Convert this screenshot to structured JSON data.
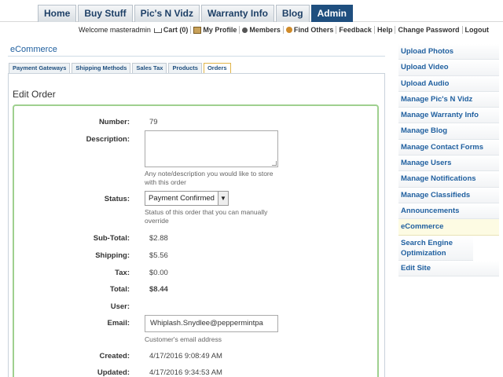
{
  "nav": {
    "tabs": [
      "Home",
      "Buy Stuff",
      "Pic's N Vidz",
      "Warranty Info",
      "Blog",
      "Admin"
    ],
    "active": "Admin"
  },
  "userbar": {
    "welcome": "Welcome masteradmin",
    "cart": "Cart (0)",
    "my_profile": "My Profile",
    "members": "Members",
    "find_others": "Find Others",
    "feedback": "Feedback",
    "help": "Help",
    "change_password": "Change Password",
    "logout": "Logout"
  },
  "section_title": "eCommerce",
  "subtabs": [
    "Payment Gateways",
    "Shipping Methods",
    "Sales Tax",
    "Products",
    "Orders"
  ],
  "active_subtab": "Orders",
  "edit_title": "Edit Order",
  "form": {
    "number_label": "Number:",
    "number": "79",
    "description_label": "Description:",
    "description_value": "",
    "description_help": "Any note/description you would like to store with this order",
    "status_label": "Status:",
    "status_value": "Payment Confirmed",
    "status_help": "Status of this order that you can manually override",
    "subtotal_label": "Sub-Total:",
    "subtotal": "$2.88",
    "shipping_label": "Shipping:",
    "shipping": "$5.56",
    "tax_label": "Tax:",
    "tax": "$0.00",
    "total_label": "Total:",
    "total": "$8.44",
    "user_label": "User:",
    "user": "",
    "email_label": "Email:",
    "email_value": "Whiplash.Snydlee@peppermintpa",
    "email_help": "Customer's email address",
    "created_label": "Created:",
    "created": "4/17/2016 9:08:49 AM",
    "updated_label": "Updated:",
    "updated": "4/17/2016 9:34:53 AM"
  },
  "sidebar": {
    "items": [
      "Upload Photos",
      "Upload Video",
      "Upload Audio",
      "Manage Pic's N Vidz",
      "Manage Warranty Info",
      "Manage Blog",
      "Manage Contact Forms",
      "Manage Users",
      "Manage Notifications",
      "Manage Classifieds",
      "Announcements",
      "eCommerce",
      "Search Engine Optimization",
      "Edit Site"
    ],
    "active": "eCommerce"
  }
}
